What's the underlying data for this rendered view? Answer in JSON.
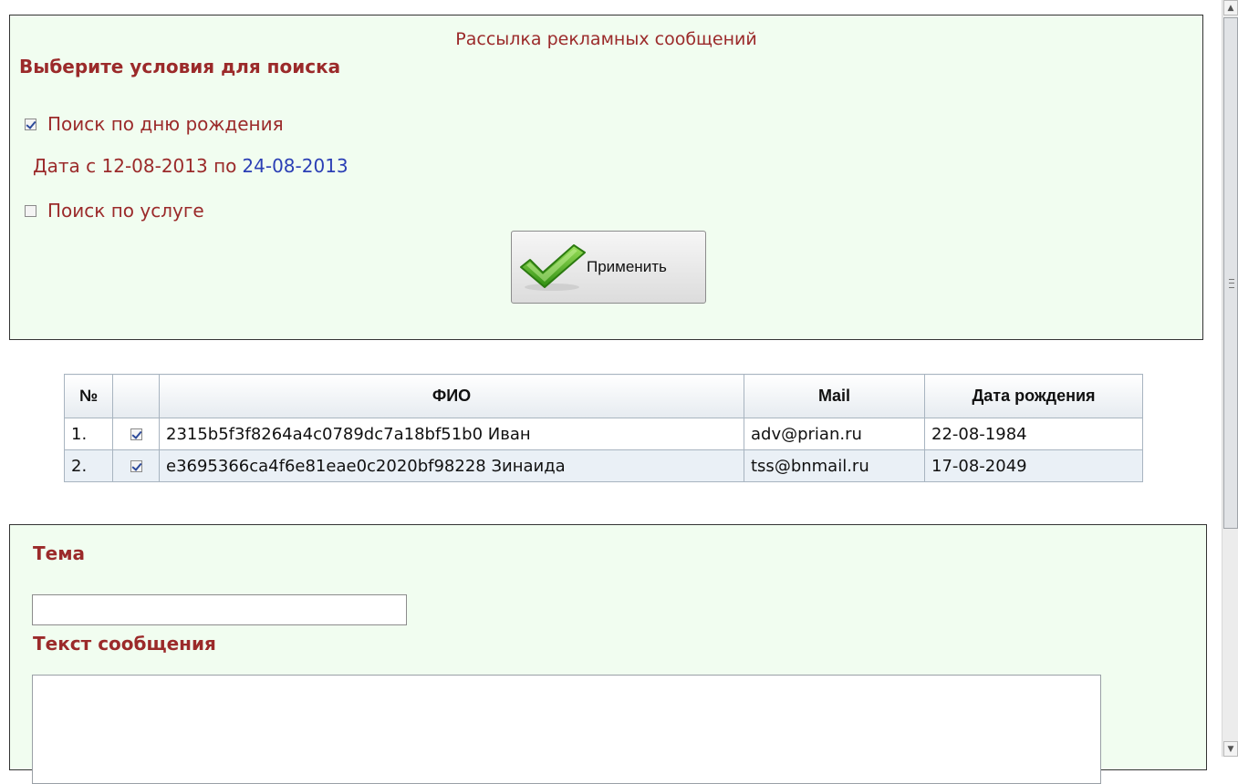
{
  "search_panel": {
    "title": "Рассылка рекламных сообщений",
    "heading": "Выберите условия для поиска",
    "birthday_search": {
      "label": "Поиск по дню рождения",
      "checked": true
    },
    "date_range": {
      "from_label": "Дата с 12-08-2013 по",
      "to_value": "24-08-2013"
    },
    "service_search": {
      "label": "Поиск по услуге",
      "checked": false
    },
    "apply_button": {
      "label": "Применить",
      "icon": "checkmark-icon"
    }
  },
  "results_table": {
    "headers": [
      "№",
      "",
      "ФИО",
      "Mail",
      "Дата рождения"
    ],
    "rows": [
      {
        "num": "1.",
        "checked": true,
        "fio": "2315b5f3f8264a4c0789dc7a18bf51b0 Иван",
        "mail": "adv@prian.ru",
        "birth": "22-08-1984"
      },
      {
        "num": "2.",
        "checked": true,
        "fio": "e3695366ca4f6e81eae0c2020bf98228 Зинаида",
        "mail": "tss@bnmail.ru",
        "birth": "17-08-2049"
      }
    ]
  },
  "message_panel": {
    "subject_label": "Тема",
    "subject_value": "",
    "text_label": "Текст сообщения",
    "text_value": ""
  },
  "colors": {
    "panel_bg": "#f1fdf0",
    "label_red": "#9b2a2a",
    "link_blue": "#2b3fb5"
  }
}
